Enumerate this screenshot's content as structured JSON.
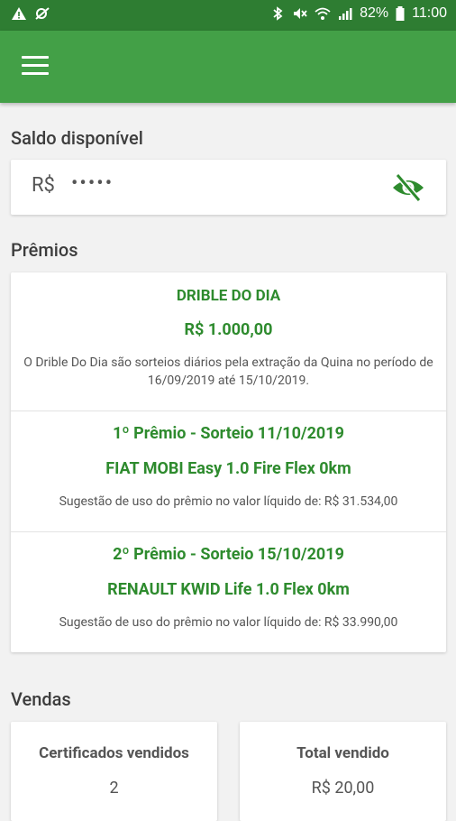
{
  "status_bar": {
    "battery": "82%",
    "time": "11:00"
  },
  "balance": {
    "section_title": "Saldo disponível",
    "currency": "R$",
    "masked_value": "•••••"
  },
  "prizes": {
    "section_title": "Prêmios",
    "main": {
      "title": "DRIBLE DO DIA",
      "amount": "R$ 1.000,00",
      "description": "O Drible Do Dia são sorteios diários pela extração da Quina no período de 16/09/2019 até 15/10/2019."
    },
    "items": [
      {
        "title": "1º Prêmio - Sorteio 11/10/2019",
        "prize": "FIAT MOBI Easy 1.0 Fire Flex 0km",
        "suggestion": "Sugestão de uso do prêmio no valor líquido de: R$ 31.534,00"
      },
      {
        "title": "2º Prêmio - Sorteio 15/10/2019",
        "prize": "RENAULT KWID Life 1.0 Flex 0km",
        "suggestion": "Sugestão de uso do prêmio no valor líquido de: R$ 33.990,00"
      }
    ]
  },
  "sales": {
    "section_title": "Vendas",
    "certificates_label": "Certificados vendidos",
    "certificates_value": "2",
    "total_label": "Total vendido",
    "total_value": "R$ 20,00"
  },
  "colors": {
    "statusbar": "#2e7d32",
    "appbar": "#43a047",
    "accent_green": "#2e8b2e"
  }
}
